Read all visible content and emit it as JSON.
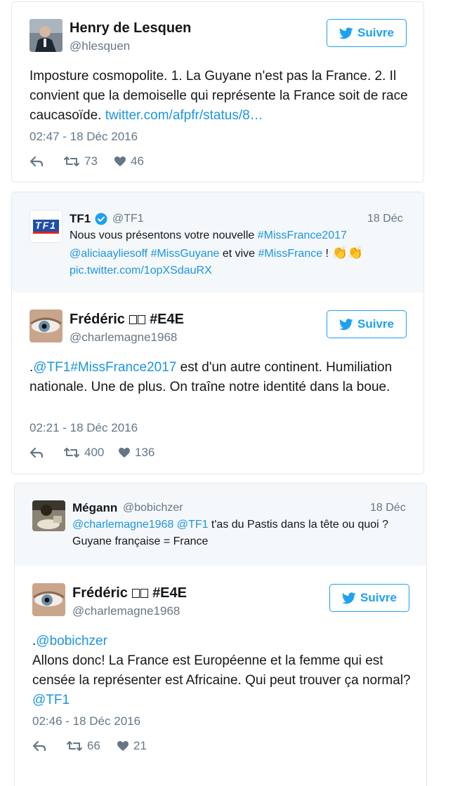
{
  "tweet1": {
    "name": "Henry de Lesquen",
    "handle": "@hlesquen",
    "follow_label": "Suivre",
    "text_plain": "Imposture cosmopolite. 1. La Guyane n'est pas la France. 2. Il convient que la demoiselle qui représente la France soit de race caucasoïde. ",
    "text_link": "twitter.com/afpfr/status/8…",
    "timestamp": "02:47 - 18 Déc 2016",
    "retweets": "73",
    "likes": "46"
  },
  "tweet2": {
    "quoted": {
      "name": "TF1",
      "handle": "@TF1",
      "date": "18 Déc",
      "text_1": "Nous vous présentons votre nouvelle ",
      "hashtag_1": "#MissFrance2017",
      "mention_1": "@aliciaayliesoff",
      "hashtag_2": "#MissGuyane",
      "text_2": " et vive ",
      "hashtag_3": "#MissFrance",
      "text_3": " ! ",
      "emoji": "👏👏",
      "pic_link": "pic.twitter.com/1opXSdauRX",
      "logo_text": "TF1"
    },
    "name_prefix": "Frédéric",
    "name_suffix": "#E4E",
    "handle": "@charlemagne1968",
    "follow_label": "Suivre",
    "text_dot": ".",
    "mention": "@TF1",
    "hashtag": "#MissFrance2017",
    "text_rest": " est d'un autre continent. Humiliation nationale. Une de plus. On traîne notre identité dans la boue.",
    "timestamp": "02:21 - 18 Déc 2016",
    "retweets": "400",
    "likes": "136"
  },
  "tweet3": {
    "quoted": {
      "name": "Mégann",
      "handle": "@bobichzer",
      "date": "18 Déc",
      "mention_1": "@charlemagne1968",
      "mention_2": "@TF1",
      "text": " t'as du Pastis dans la tête ou quoi ? Guyane française = France"
    },
    "name_prefix": "Frédéric",
    "name_suffix": "#E4E",
    "handle": "@charlemagne1968",
    "follow_label": "Suivre",
    "text_dot": ".",
    "mention_1": "@bobichzer",
    "text_body": "Allons donc! La France est Européenne et la femme qui est censée la représenter est Africaine. Qui peut trouver ça normal?",
    "mention_2": "@TF1",
    "timestamp": "02:46 - 18 Déc 2016",
    "retweets": "66",
    "likes": "21"
  },
  "colors": {
    "link": "#1b95e0",
    "follow_blue": "#1da1f2",
    "meta_gray": "#657786",
    "quote_bg": "#f5f8fa",
    "verified": "#1da1f2"
  },
  "icons": [
    "twitter-bird-icon",
    "reply-icon",
    "retweet-icon",
    "heart-icon",
    "verified-badge-icon",
    "clap-emoji"
  ]
}
